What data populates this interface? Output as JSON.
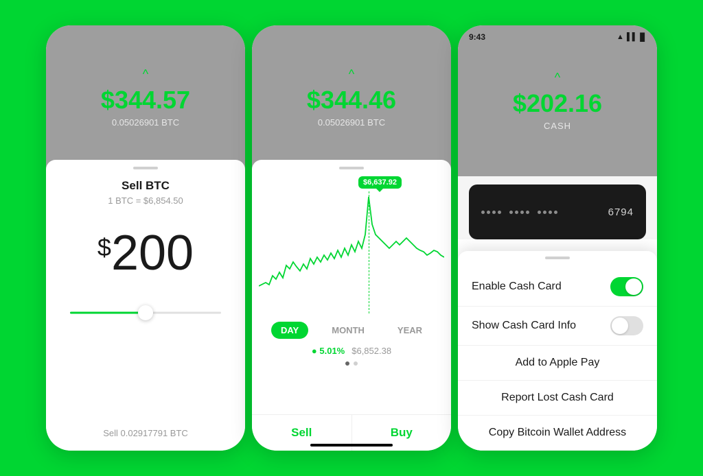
{
  "phone1": {
    "header": {
      "chevron": "^",
      "amount": "$344.57",
      "btc": "0.05026901 BTC"
    },
    "body": {
      "title": "Sell BTC",
      "subtitle": "1 BTC = $6,854.50",
      "amount": "200",
      "dollar_sign": "$",
      "sell_label": "Sell 0.02917791 BTC"
    }
  },
  "phone2": {
    "header": {
      "chevron": "^",
      "amount": "$344.46",
      "btc": "0.05026901 BTC"
    },
    "body": {
      "tooltip": "$6,637.92",
      "tabs": [
        "DAY",
        "MONTH",
        "YEAR"
      ],
      "active_tab": "DAY",
      "stat_pct": "● 5.01%",
      "stat_price": "$6,852.38",
      "sell_btn": "Sell",
      "buy_btn": "Buy"
    }
  },
  "phone3": {
    "status_bar": {
      "time": "9:43",
      "icons": "▲ ▌▌ ▊ ▊"
    },
    "header": {
      "chevron": "^",
      "amount": "$202.16",
      "sub": "CASH"
    },
    "card": {
      "number": "6794"
    },
    "sheet": {
      "handle": "",
      "rows": [
        {
          "id": "enable-cash-card",
          "label": "Enable Cash Card",
          "type": "toggle",
          "value": true
        },
        {
          "id": "show-cash-card-info",
          "label": "Show Cash Card Info",
          "type": "toggle",
          "value": false
        },
        {
          "id": "add-apple-pay",
          "label": "Add to Apple Pay",
          "type": "button"
        },
        {
          "id": "report-lost",
          "label": "Report Lost Cash Card",
          "type": "button"
        },
        {
          "id": "copy-bitcoin",
          "label": "Copy Bitcoin Wallet Address",
          "type": "button"
        }
      ]
    }
  }
}
